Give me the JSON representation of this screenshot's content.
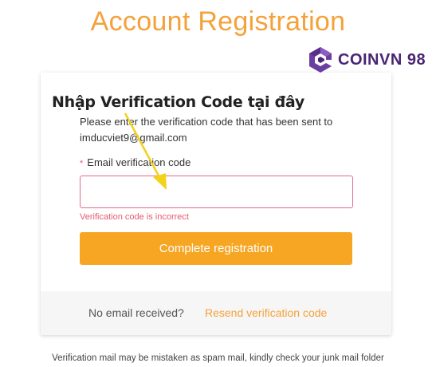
{
  "page": {
    "title": "Account Registration"
  },
  "brand": {
    "name": "COINVN 98",
    "logo_icon": "hexagon-c-logo-icon",
    "color": "#4a2474"
  },
  "annotation": {
    "text": "Nhập Verification Code tại đây",
    "arrow_color": "#f2d21b"
  },
  "card": {
    "instruction_line1": "Please enter the verification code that has been sent to",
    "instruction_line2": "imducviet9@gmail.com",
    "field": {
      "required_mark": "*",
      "label": "Email verification code",
      "value": "",
      "placeholder": ""
    },
    "error": "Verification code is incorrect",
    "submit_label": "Complete registration",
    "footer": {
      "no_email_text": "No email received?",
      "resend_label": "Resend verification code"
    }
  },
  "footnote": "Verification mail may be mistaken as spam mail, kindly check your junk mail folder",
  "colors": {
    "accent": "#f6a623",
    "title": "#f5a13a",
    "error": "#e45b6e"
  }
}
